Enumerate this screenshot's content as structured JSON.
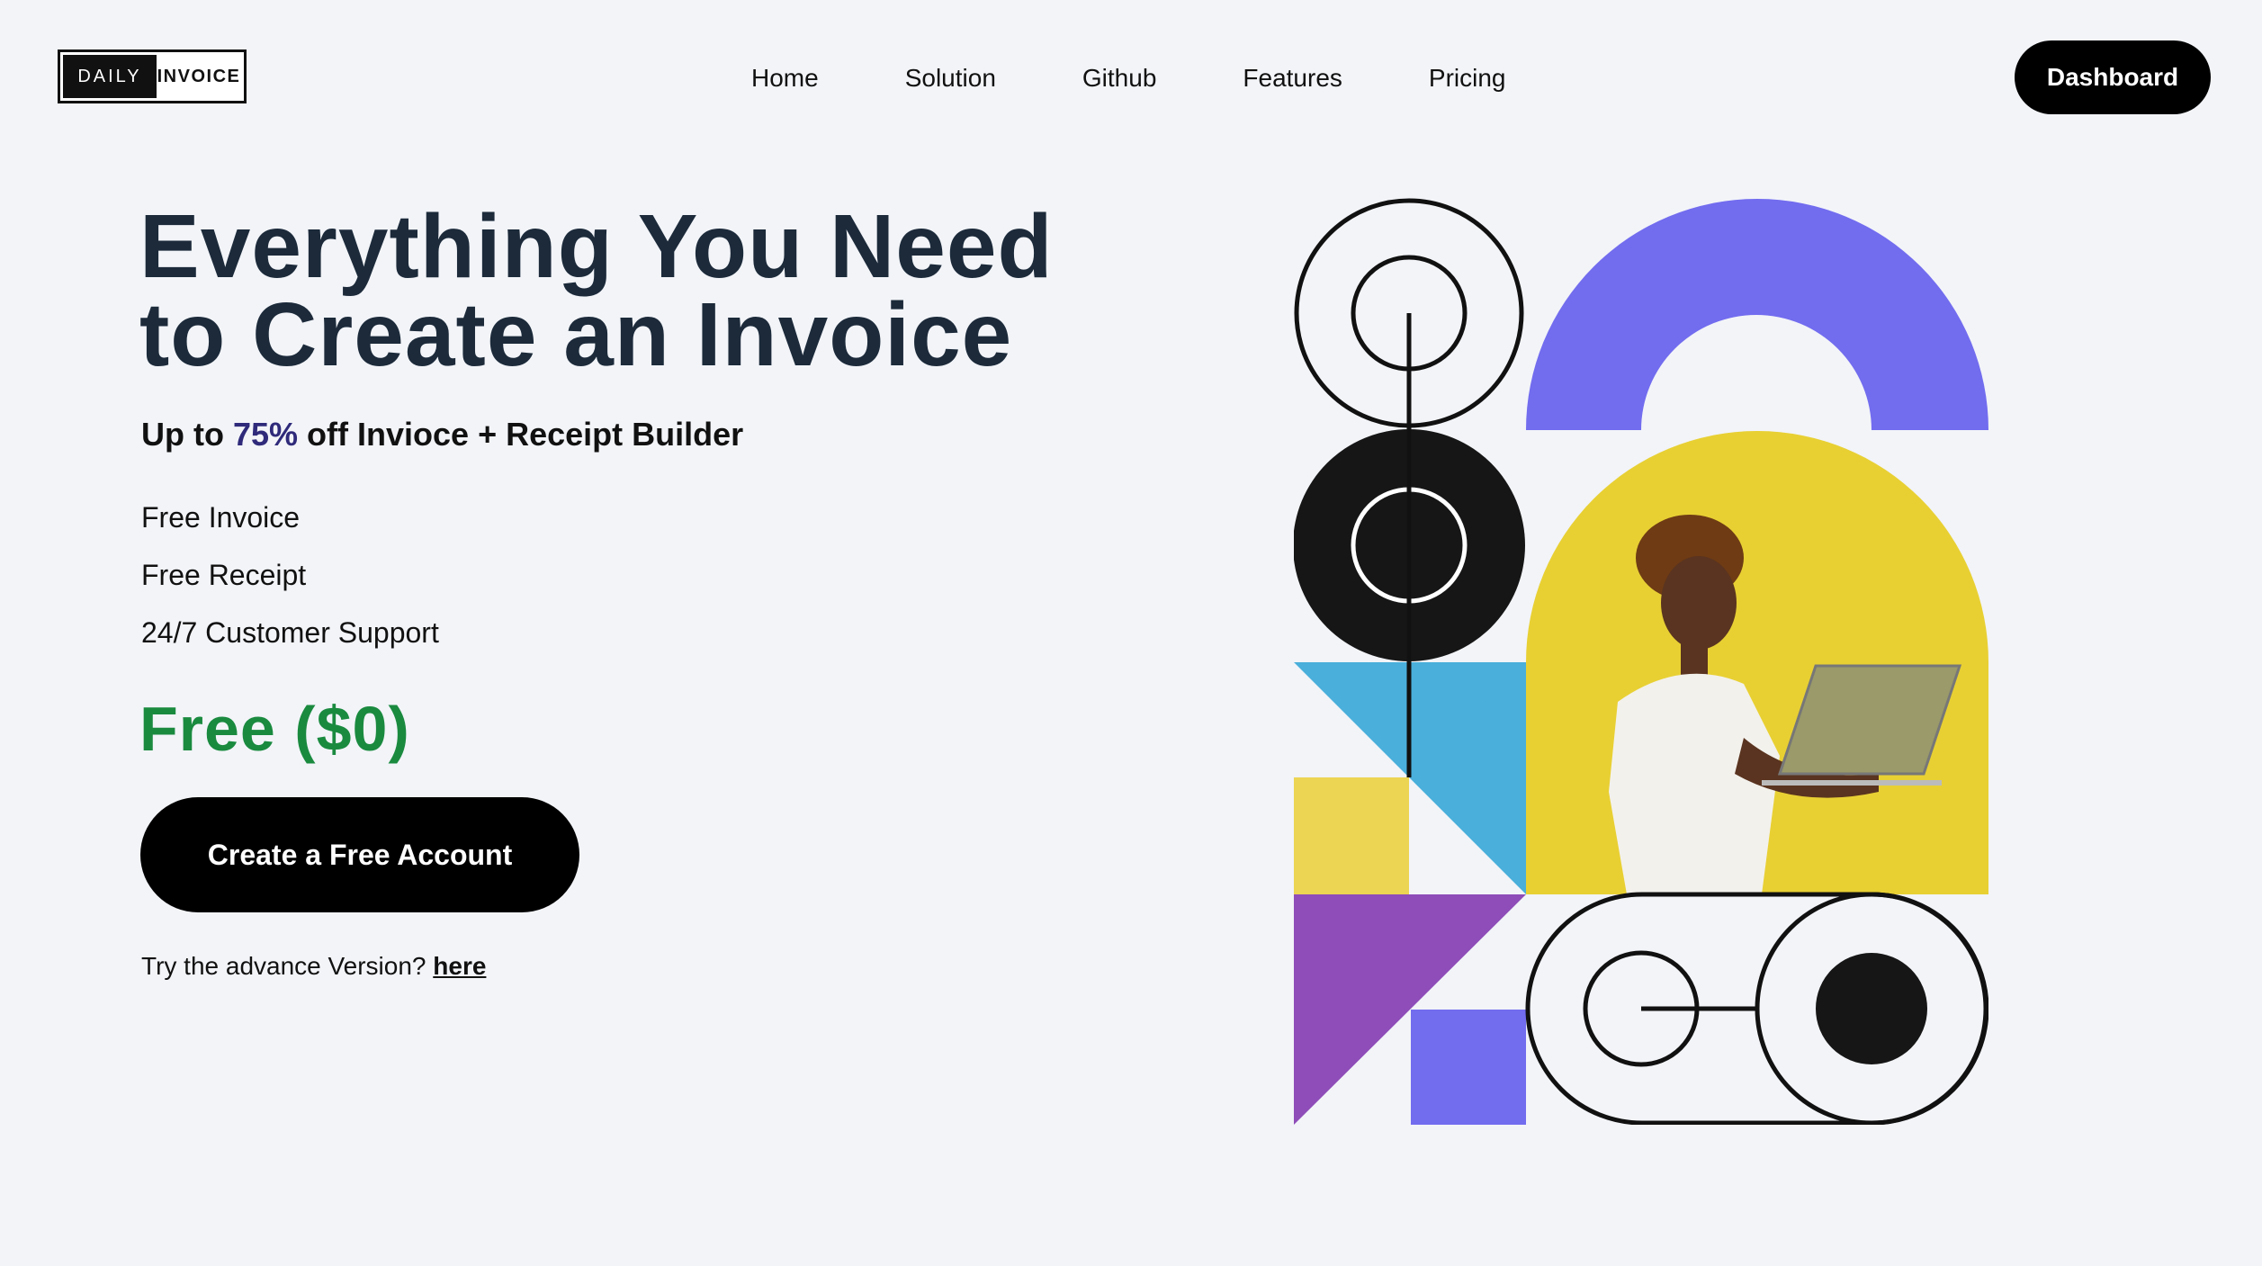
{
  "header": {
    "logo": {
      "left": "DAILY",
      "right": "INVOICE"
    },
    "nav": [
      "Home",
      "Solution",
      "Github",
      "Features",
      "Pricing"
    ],
    "dashboard_label": "Dashboard"
  },
  "hero": {
    "title_line1": "Everything You Need",
    "title_line2": "to Create an Invoice",
    "subtitle_pre": "Up to ",
    "subtitle_accent": "75%",
    "subtitle_post": " off Invioce + Receipt Builder",
    "features": [
      "Free Invoice",
      "Free Receipt",
      "24/7 Customer Support"
    ],
    "price": "Free ($0)",
    "cta_label": "Create a Free Account",
    "advance_text": "Try the advance Version? ",
    "advance_link": "here"
  },
  "colors": {
    "purple": "#726cef",
    "yellow": "#e8d033",
    "blue": "#4aafdb",
    "violet": "#8e4db8",
    "light_yellow": "#ecd553",
    "price_green": "#1a8a3f",
    "accent_navy": "#2f2a7a",
    "title_navy": "#1c2a3a"
  }
}
